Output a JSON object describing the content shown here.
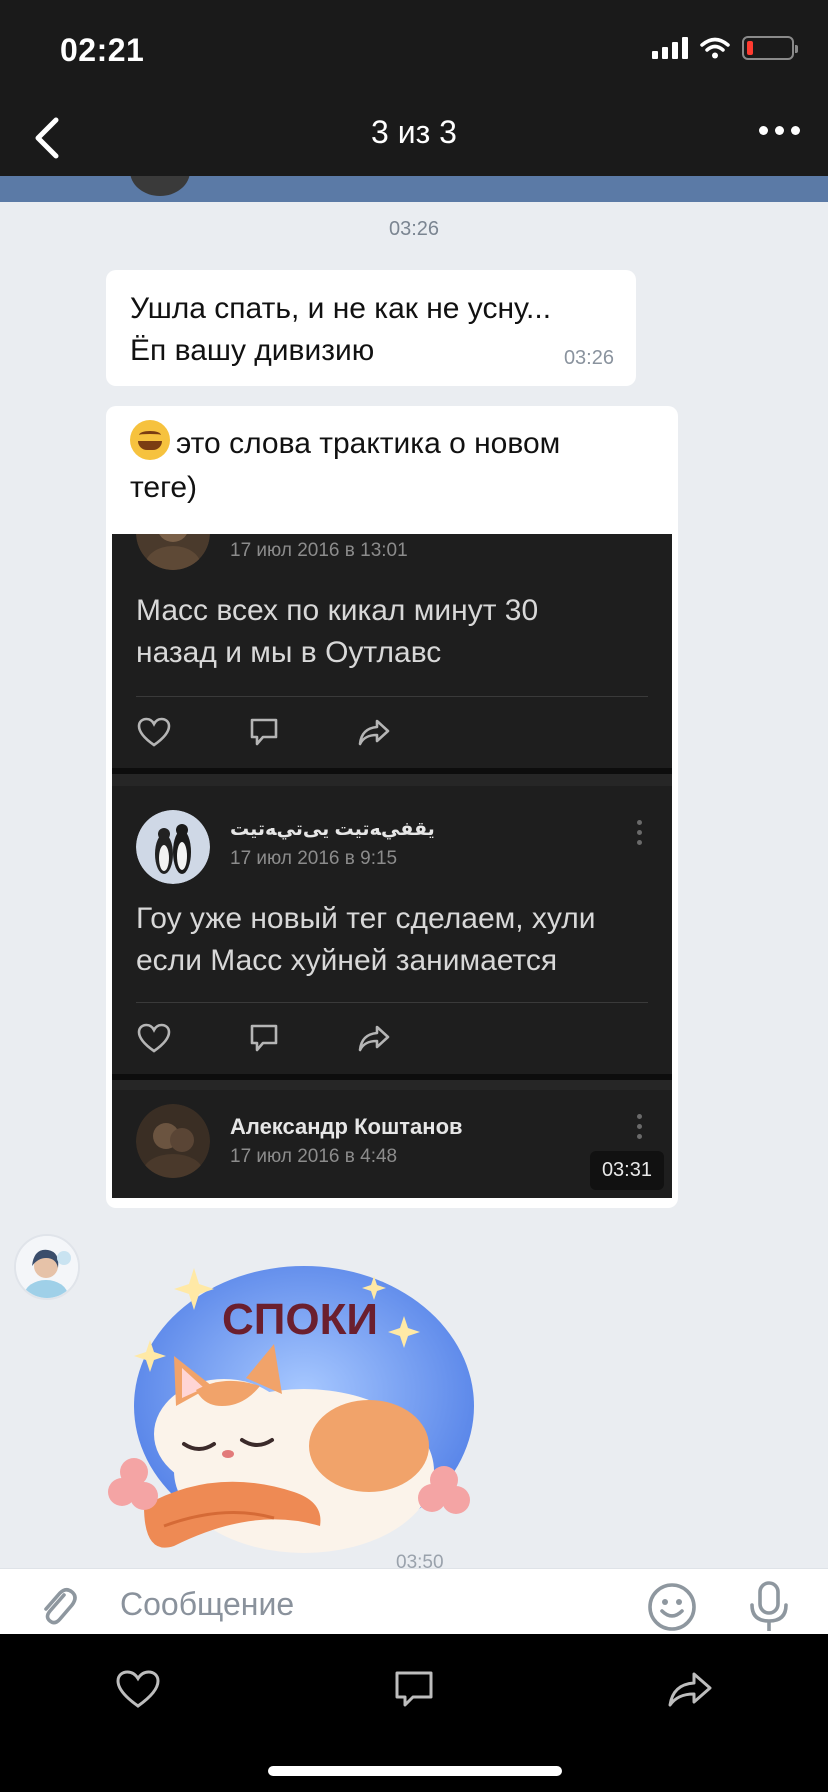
{
  "status_bar": {
    "time": "02:21",
    "icons": [
      "signal-icon",
      "wifi-icon",
      "battery-low-icon"
    ],
    "battery_color": "#ff3b30"
  },
  "header": {
    "title": "3 из 3",
    "back_icon": "chevron-left-icon",
    "more_icon": "more-horizontal-icon"
  },
  "chat": {
    "timestamp_top": "03:26",
    "messages": [
      {
        "lines": [
          "Ушла спать, и не  как не усну...",
          "Ёп вашу дивизию"
        ],
        "time": "03:26"
      },
      {
        "emoji": "rofl-emoji-icon",
        "caption_lines": [
          "это слова трактика о новом",
          "теге)"
        ],
        "screenshot": {
          "posts": [
            {
              "date": "17 июл 2016 в 13:01",
              "text_lines": [
                "Масс всех по кикал минут 30",
                "назад и  мы в Оутлавс"
              ]
            },
            {
              "author": "ﻳﻘﻔﻲﻪﺗﻴﺖ ﻳﻰﺗﻲﻪﺗﻴﺖ",
              "date": "17 июл 2016 в 9:15",
              "text_lines": [
                "Гоу уже новый тег сделаем, хули",
                "если Масс хуйней занимается"
              ]
            },
            {
              "author": "Александр Коштанов",
              "date": "17 июл 2016 в 4:48"
            }
          ]
        },
        "time": "03:31"
      }
    ],
    "sticker": {
      "text": "СПОКИ",
      "time": "03:50"
    }
  },
  "input": {
    "placeholder": "Сообщение"
  },
  "viewer_toolbar": {
    "buttons": [
      "heart-icon",
      "comment-icon",
      "share-icon"
    ]
  },
  "colors": {
    "header_bg": "#1a1a1a",
    "chat_bg": "#eaedf1",
    "accent_strip": "#5b7aa6",
    "dark_post_bg": "#1e1e1e"
  }
}
